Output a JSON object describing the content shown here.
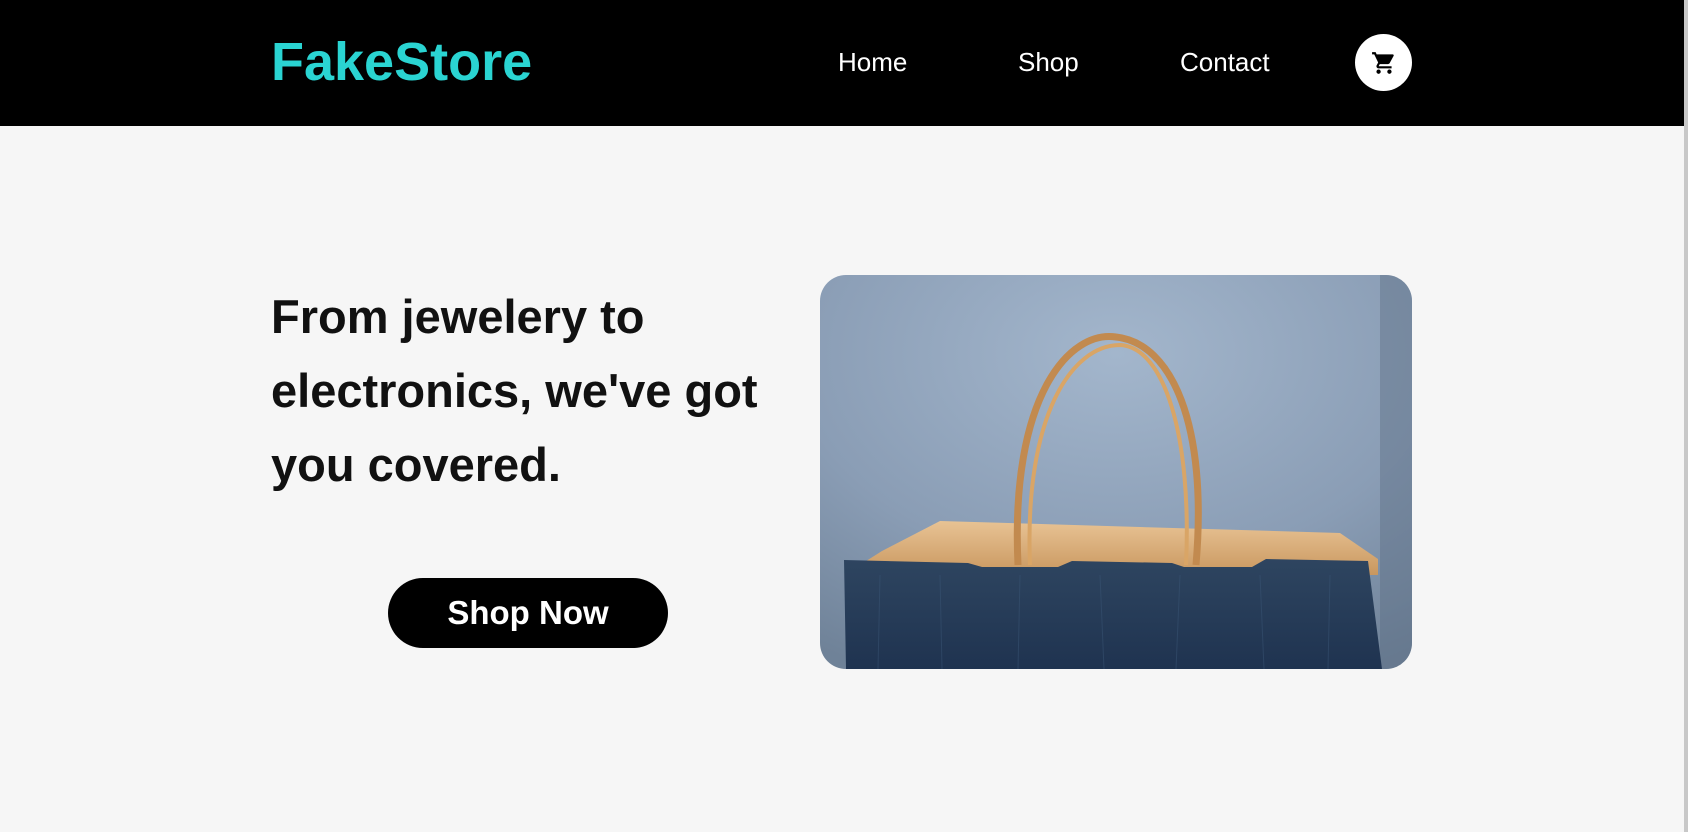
{
  "brand": {
    "name": "FakeStore",
    "color": "#2ad4d2"
  },
  "nav": {
    "items": [
      {
        "label": "Home"
      },
      {
        "label": "Shop"
      },
      {
        "label": "Contact"
      }
    ],
    "cart_icon": "shopping-cart-icon"
  },
  "hero": {
    "heading": "From jewelery to electronics, we've got you covered.",
    "cta_label": "Shop Now",
    "image": "shopping-bag-photo"
  },
  "colors": {
    "navbar_bg": "#000000",
    "page_bg": "#f6f6f6",
    "button_bg": "#000000"
  }
}
